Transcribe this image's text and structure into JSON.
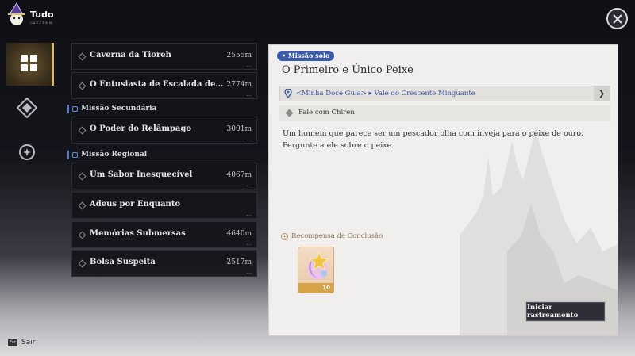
{
  "app": {
    "title": "Tudo",
    "subtitle": "ᴄᴀᴇᴊʏᴍᴍ"
  },
  "nav": [
    {
      "id": "all",
      "icon": "all-quests-icon",
      "active": true
    },
    {
      "id": "tracked",
      "icon": "compass-diamond-icon",
      "active": false
    },
    {
      "id": "other",
      "icon": "star-circle-icon",
      "active": false
    }
  ],
  "quests": {
    "main": [
      {
        "name": "Caverna da Tioreh",
        "distance": "2555m"
      },
      {
        "name": "O Entusiasta de Escalada de Quat...",
        "distance": "2774m"
      }
    ],
    "secondary_header": "Missão Secundária",
    "secondary": [
      {
        "name": "O Poder do Relâmpago",
        "distance": "3001m"
      }
    ],
    "regional_header": "Missão Regional",
    "regional": [
      {
        "name": "Um Sabor Inesquecível",
        "distance": "4067m"
      },
      {
        "name": "Adeus por Enquanto",
        "distance": ""
      },
      {
        "name": "Memórias Submersas",
        "distance": "4640m"
      },
      {
        "name": "Bolsa Suspeita",
        "distance": "2517m"
      }
    ]
  },
  "detail": {
    "tag": "• Missão solo",
    "title": "O Primeiro e Único Peixe",
    "location": "<Minha Doce Gula> ▸ Vale do Crescente Minguante",
    "step": "Fale com Chiren",
    "description": "Um homem que parece ser um pescador olha com inveja para o peixe de ouro. Pergunte a ele sobre o peixe.",
    "reward_header": "Recompensa de Conclusão",
    "reward_count": "10",
    "track_button": "Iniciar rastreamento"
  },
  "footer": {
    "key": "Esc",
    "exit_label": "Sair"
  },
  "colors": {
    "accent_gold": "#d8b770",
    "tag_blue": "#3b5aa8",
    "location_blue": "#3f56a0"
  }
}
